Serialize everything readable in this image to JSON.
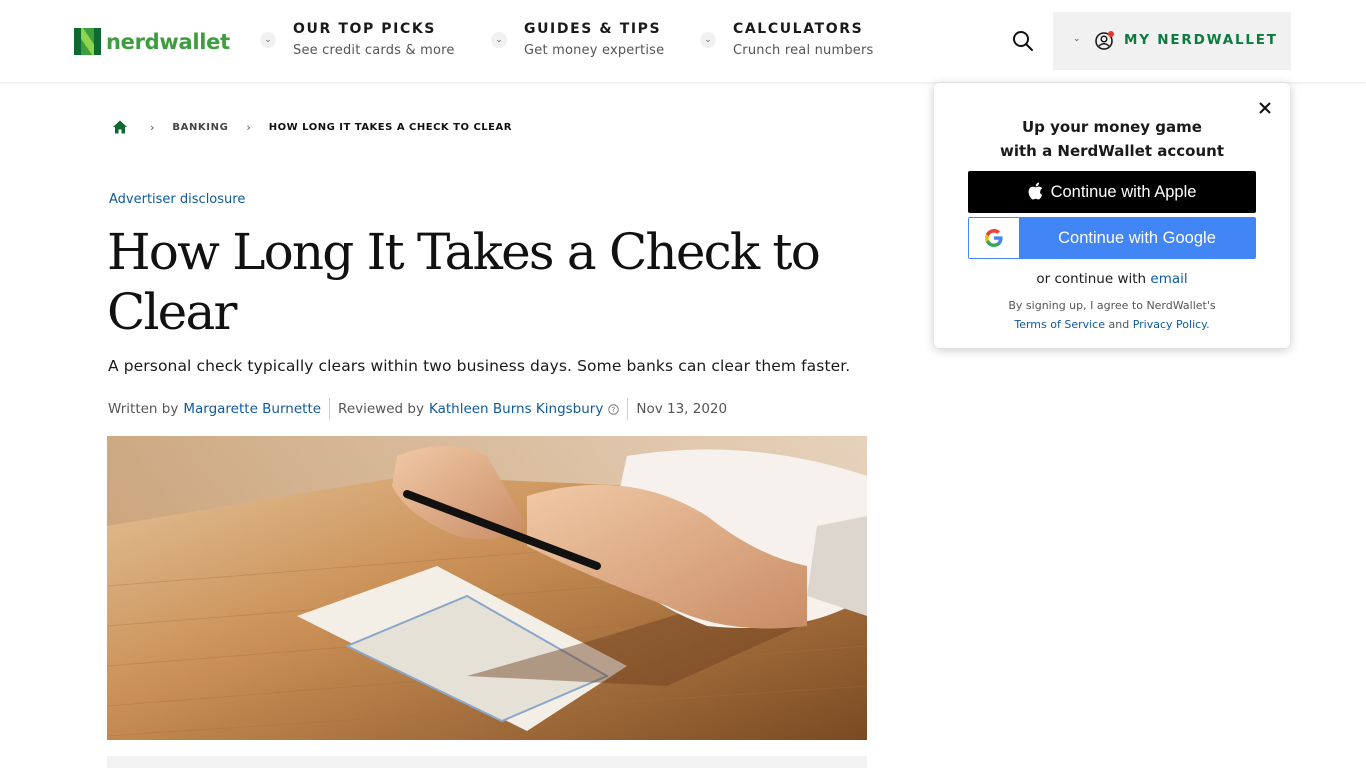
{
  "header": {
    "logo_text": "nerdwallet",
    "brand_color": "#3e9e3f",
    "nav": [
      {
        "title": "OUR TOP PICKS",
        "subtitle": "See credit cards & more"
      },
      {
        "title": "GUIDES & TIPS",
        "subtitle": "Get money expertise"
      },
      {
        "title": "CALCULATORS",
        "subtitle": "Crunch real numbers"
      }
    ],
    "search_icon": "search-icon",
    "account_label": "MY NERDWALLET",
    "account_color": "#0d7a3e"
  },
  "breadcrumb": {
    "home_icon": "home-icon",
    "items": [
      "BANKING",
      "HOW LONG IT TAKES A CHECK TO CLEAR"
    ]
  },
  "article": {
    "disclosure": "Advertiser disclosure",
    "title": "How Long It Takes a Check to Clear",
    "subtitle": "A personal check typically clears within two business days. Some banks can clear them faster.",
    "written_by_label": "Written by",
    "author": "Margarette Burnette",
    "reviewed_by_label": "Reviewed by",
    "reviewer": "Kathleen Burns Kingsbury",
    "date": "Nov 13, 2020",
    "link_color": "#0e5a9c"
  },
  "popup": {
    "heading_line1": "Up your money game",
    "heading_line2": "with a NerdWallet account",
    "apple_button": "Continue with Apple",
    "google_button": "Continue with Google",
    "google_color": "#4285f4",
    "or_text": "or continue with",
    "email_link": "email",
    "terms_prefix": "By signing up, I agree to NerdWallet's",
    "terms_link": "Terms of Service",
    "terms_and": "and",
    "privacy_link": "Privacy Policy",
    "terms_end": "."
  }
}
